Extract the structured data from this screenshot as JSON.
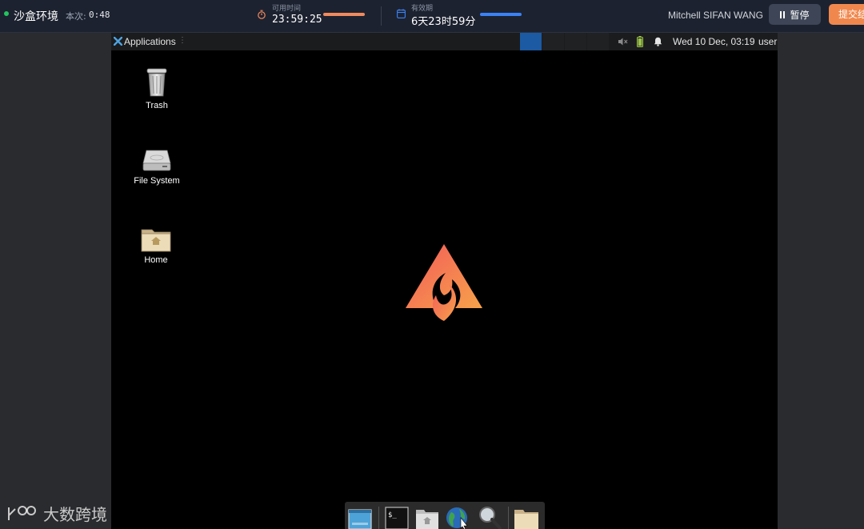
{
  "topbar": {
    "env_title": "沙盒环境",
    "session_label": "本次:",
    "session_value": "0:48",
    "available_label": "可用时间",
    "available_value": "23:59:25",
    "validity_label": "有效期",
    "validity_value": "6天23时59分",
    "user_name": "Mitchell SIFAN WANG",
    "pause_label": "暂停",
    "submit_label": "提交结"
  },
  "panel": {
    "applications_label": "Applications",
    "clock": "Wed 10 Dec, 03:19",
    "user": "user",
    "workspaces": 4,
    "active_workspace": 1
  },
  "desktop": {
    "icons": [
      {
        "label": "Trash",
        "icon": "trash-icon"
      },
      {
        "label": "File System",
        "icon": "drive-icon"
      },
      {
        "label": "Home",
        "icon": "home-folder-icon"
      }
    ]
  },
  "dock": {
    "items": [
      "show-desktop-icon",
      "terminal-icon",
      "home-folder-icon",
      "web-browser-icon",
      "search-icon",
      "folder-icon"
    ]
  },
  "watermark": {
    "text": "大数跨境"
  },
  "colors": {
    "accent_orange": "#f0884e",
    "accent_blue": "#3b82f6",
    "status_green": "#22c55e",
    "workspace_active": "#1c5aa3"
  }
}
